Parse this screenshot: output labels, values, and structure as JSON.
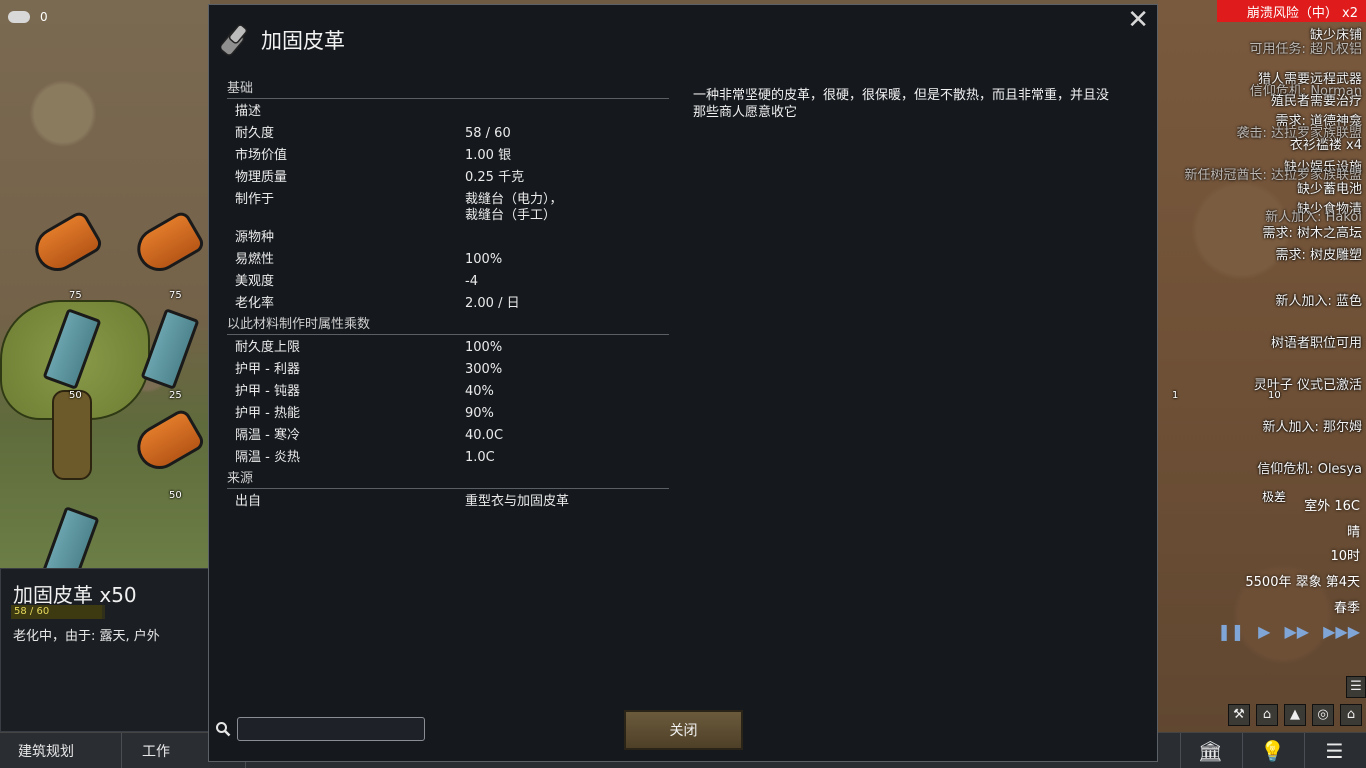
{
  "hud": {
    "resource_count": "0",
    "resource_icon": "silver-coins-icon"
  },
  "world_items": [
    {
      "count": "75"
    },
    {
      "count": "75"
    },
    {
      "count": "50"
    },
    {
      "count": "25"
    },
    {
      "count": "50"
    }
  ],
  "right_world_labels": {
    "count_a": "1",
    "count_b": "10",
    "quality": "极差"
  },
  "alerts": {
    "top_alert": "崩溃风险（中） x2",
    "lines": [
      "缺少床铺",
      "可用任务: 超凡权铝",
      "猎人需要远程武器",
      "信仰危机: Norman",
      "殖民者需要治疗",
      "需求: 道德神龛",
      "袭击: 达拉罗家族联盟",
      "衣衫褴褛 x4",
      "缺少娱乐设施",
      "新任树冠酋长: 达拉罗家族联盟",
      "缺少蓄电池",
      "缺少食物清",
      "新人加入: Hakoi",
      "需求: 树木之高坛",
      "需求: 树皮雕塑",
      "新人加入: 蓝色",
      "树语者职位可用",
      "灵叶子 仪式已激活",
      "新人加入: 那尔姆",
      "信仰危机: Olesya"
    ]
  },
  "world_info": {
    "temperature": "室外 16C",
    "weather": "晴",
    "time": "10时",
    "date": "5500年 翠象 第4天",
    "season": "春季"
  },
  "speed_controls": {
    "pause": "❚❚",
    "normal": "▶",
    "fast": "▶▶",
    "fastest": "▶▶▶"
  },
  "bottom_bar": {
    "tab_architect": "建筑规划",
    "tab_work": "工作"
  },
  "inspect": {
    "title": "加固皮革 x50",
    "hp_text": "58 / 60",
    "hp_fraction": 0.967,
    "status": "老化中，由于: 露天, 户外"
  },
  "dialog": {
    "icon": "leather-roll-icon",
    "title": "加固皮革",
    "description": "一种非常坚硬的皮革，很硬，很保暖，但是不散热，而且非常重，并且没那些商人愿意收它",
    "sections": [
      {
        "heading": "基础",
        "rows": [
          {
            "label": "描述",
            "value": ""
          },
          {
            "label": "耐久度",
            "value": "58 / 60"
          },
          {
            "label": "市场价值",
            "value": "1.00 银"
          },
          {
            "label": "物理质量",
            "value": "0.25 千克"
          },
          {
            "label": "制作于",
            "value": "裁缝台（电力），\n裁缝台（手工）"
          },
          {
            "label": "源物种",
            "value": ""
          },
          {
            "label": "易燃性",
            "value": "100%"
          },
          {
            "label": "美观度",
            "value": "-4"
          },
          {
            "label": "老化率",
            "value": "2.00 / 日"
          }
        ]
      },
      {
        "heading": "以此材料制作时属性乘数",
        "rows": [
          {
            "label": "耐久度上限",
            "value": "100%"
          },
          {
            "label": "护甲 - 利器",
            "value": "300%"
          },
          {
            "label": "护甲 - 钝器",
            "value": "40%"
          },
          {
            "label": "护甲 - 热能",
            "value": "90%"
          },
          {
            "label": "隔温 - 寒冷",
            "value": "40.0C"
          },
          {
            "label": "隔温 - 炎热",
            "value": "1.0C"
          }
        ]
      },
      {
        "heading": "来源",
        "rows": [
          {
            "label": "出自",
            "value": "重型衣与加固皮革"
          }
        ]
      }
    ],
    "search": {
      "value": "",
      "placeholder": ""
    },
    "close_button": "关闭"
  }
}
